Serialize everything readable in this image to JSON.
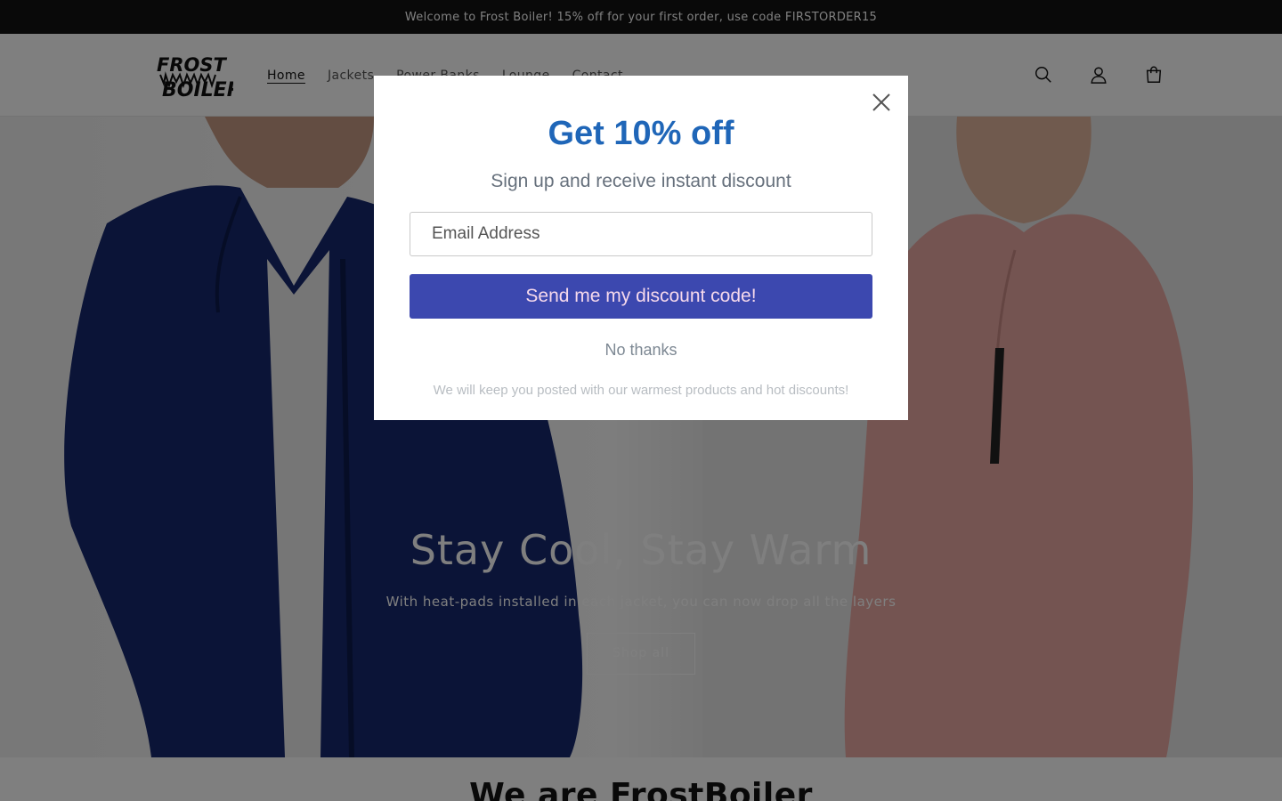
{
  "announcement": "Welcome to Frost Boiler! 15% off for your first order, use code FIRSTORDER15",
  "header": {
    "logo_line1": "FROST",
    "logo_line2": "BOILER",
    "nav": [
      "Home",
      "Jackets",
      "Power Banks",
      "Lounge",
      "Contact"
    ],
    "active_nav": "Home",
    "icons": [
      "search-icon",
      "account-icon",
      "cart-icon"
    ]
  },
  "hero": {
    "title": "Stay Cool, Stay Warm",
    "subtitle": "With heat-pads installed in each jacket, you can now drop all the layers",
    "button": "Shop all",
    "colors": {
      "mens_jacket": "#16286e",
      "womens_jacket": "#e9a9a3"
    }
  },
  "section": {
    "title": "We are FrostBoiler"
  },
  "popup": {
    "title": "Get 10% off",
    "subtitle": "Sign up and receive instant discount",
    "email_placeholder": "Email Address",
    "submit_label": "Send me my discount code!",
    "decline_label": "No thanks",
    "footnote": "We will keep you posted with our warmest products and hot discounts!",
    "colors": {
      "title": "#1f66b8",
      "button": "#3c48af",
      "button_text": "#f6d9ec"
    }
  }
}
